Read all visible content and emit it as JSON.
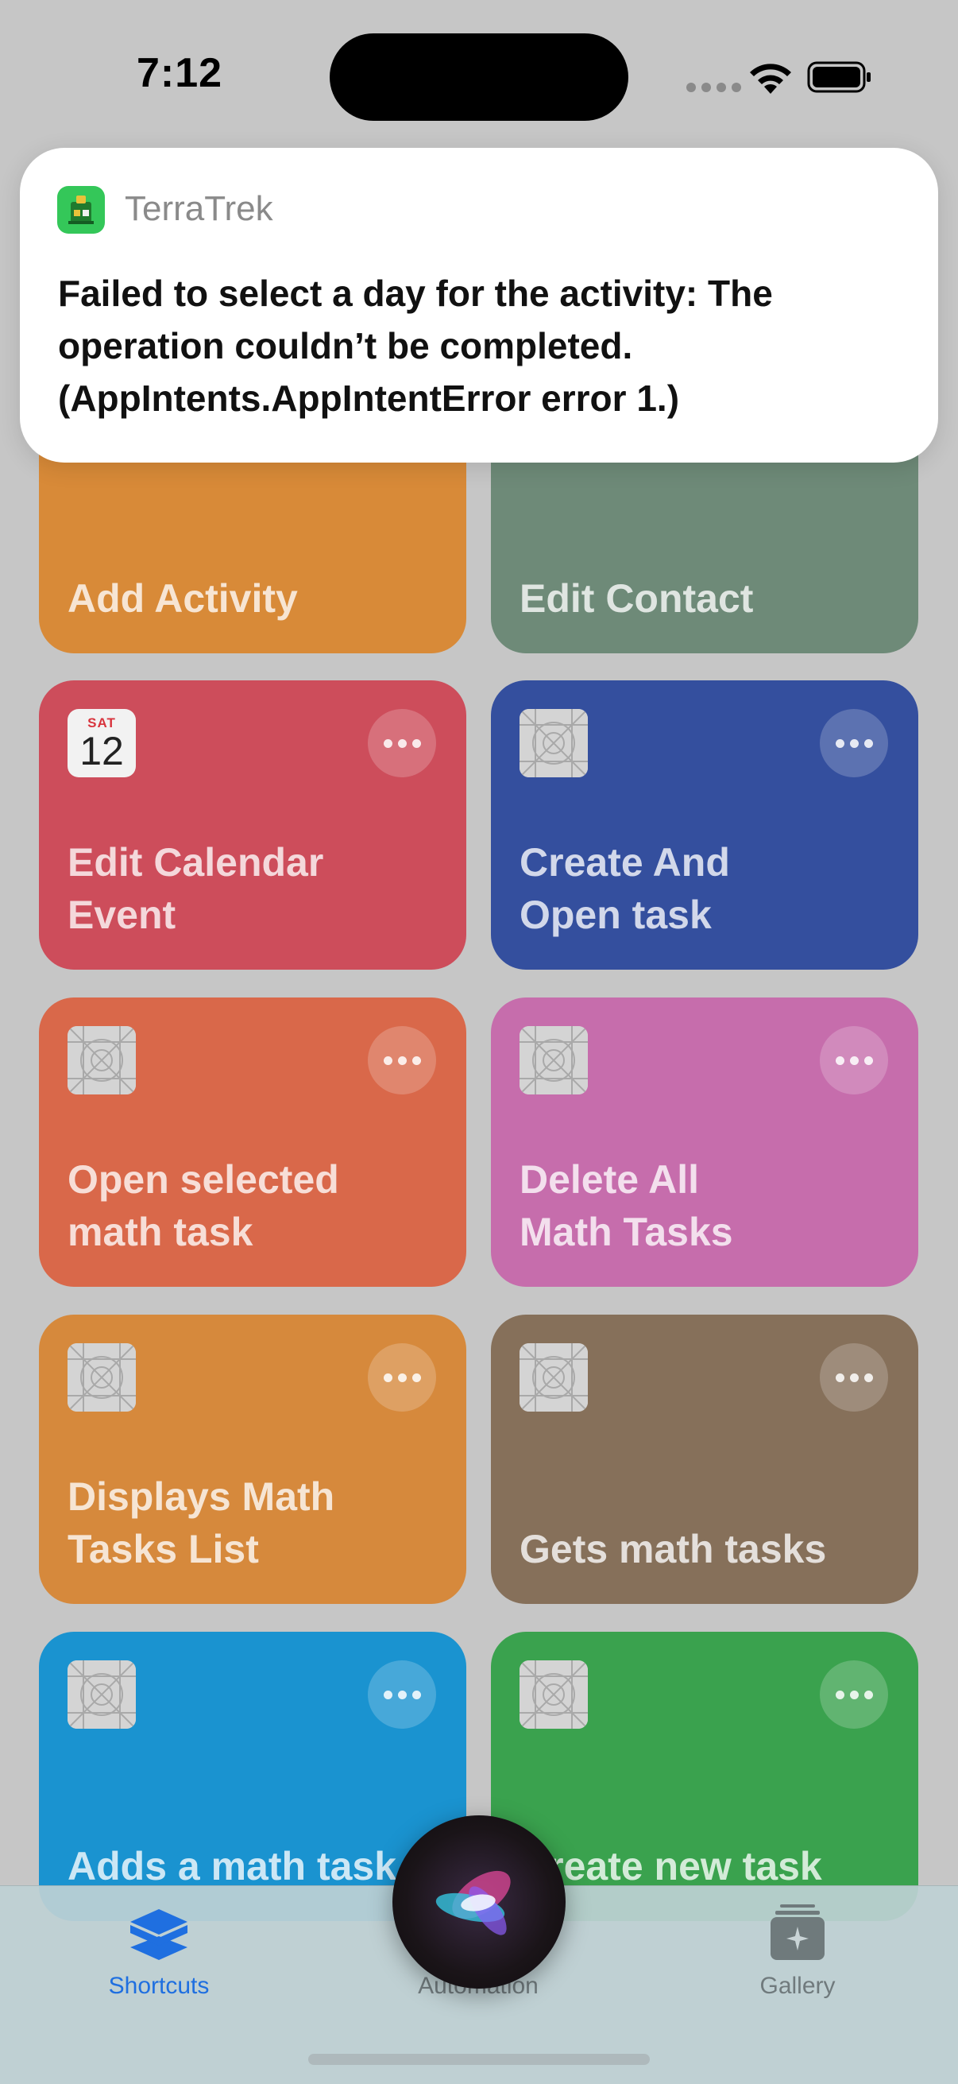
{
  "status_bar": {
    "time": "7:12"
  },
  "notification": {
    "app_name": "TerraTrek",
    "message": "Failed to select a day for the activity: The operation couldn’t be completed. (AppIntents.AppIntentError error 1.)"
  },
  "tiles": [
    {
      "title": "Add Activity",
      "color": "#d88a38"
    },
    {
      "title": "Edit Contact",
      "color": "#6e8a78"
    },
    {
      "title": "Edit Calendar\nEvent",
      "color": "#cd4d5b",
      "calendar_day": "SAT",
      "calendar_date": "12"
    },
    {
      "title": "Create And\nOpen task",
      "color": "#344f9e"
    },
    {
      "title": "Open selected\nmath task",
      "color": "#d9684a"
    },
    {
      "title": "Delete All\nMath Tasks",
      "color": "#c66dac"
    },
    {
      "title": "Displays Math\nTasks List",
      "color": "#d6893c"
    },
    {
      "title": "Gets math tasks",
      "color": "#86705a"
    },
    {
      "title": "Adds a math task",
      "color": "#1a93d0"
    },
    {
      "title": "Create new task",
      "color": "#3aa24e"
    }
  ],
  "tabbar": {
    "shortcuts": "Shortcuts",
    "automation": "Automation",
    "gallery": "Gallery",
    "active_color": "#1f6fe0"
  }
}
